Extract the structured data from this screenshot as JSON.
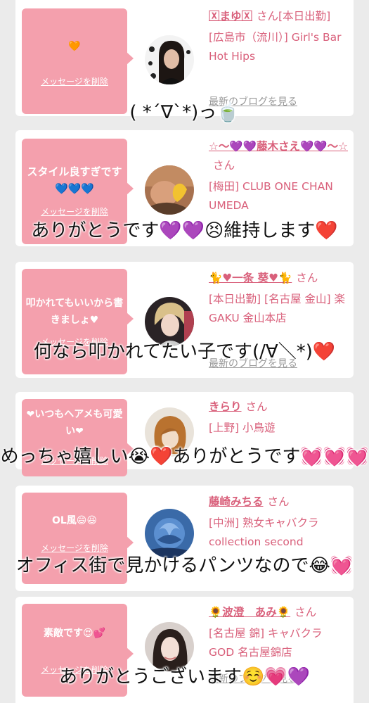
{
  "delete_label": "メッセージを削除",
  "blog_label": "最新のブログを見る",
  "san": "さん",
  "cards": [
    {
      "message": "🧡",
      "name": "🅇まゆ🅇",
      "suffix": "さん[本日出勤]",
      "shop": "[広島市（流川）] Girl's Bar Hot Hips",
      "comment": "( *´∇`*)っ🍵"
    },
    {
      "message": "スタイル良すぎです💙💙💙",
      "name": "☆〜💜💜藤木さえ💜💜〜☆",
      "suffix": "さん",
      "shop": "[梅田] CLUB ONE CHAN UMEDA",
      "comment": "ありがとうです💜💜😣維持します❤️"
    },
    {
      "message": "叩かれてもいいから書きましょ♥",
      "name": "🐈♥一条 葵♥🐈",
      "suffix": "さん",
      "shop": "[本日出勤] [名古屋 金山] 楽GAKU 金山本店",
      "comment": "何なら叩かれてたい子です(/∀＼*)❤️"
    },
    {
      "message": "❤いつもヘアメも可愛い❤",
      "name": "きらり",
      "suffix": "さん",
      "shop": "[上野] 小鳥遊",
      "comment": "めっちゃ嬉しい😭❤️ありがとうです💓💓💓"
    },
    {
      "message": "OL風😄😆",
      "name": "藤崎みちる",
      "suffix": "さん",
      "shop": "[中洲] 熟女キャバクラ collection second",
      "comment": "オフィス街で見かけるパンツなので😂💓"
    },
    {
      "message": "素敵です😍💕",
      "name": "🌻波澄　あみ🌻",
      "suffix": "さん",
      "shop": "[名古屋 錦] キャバクラ GOD 名古屋錦店",
      "comment": "ありがとうございます☺️💗💜"
    }
  ]
}
